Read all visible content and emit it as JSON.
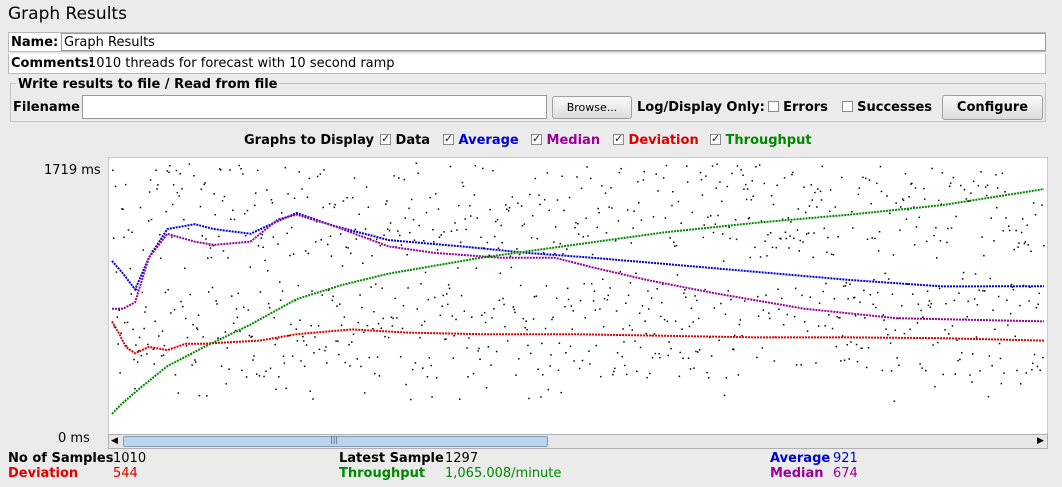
{
  "title": "Graph Results",
  "name": {
    "label": "Name:",
    "value": "Graph Results"
  },
  "comments": {
    "label": "Comments:",
    "value": "1010 threads for forecast with 10 second ramp"
  },
  "file_group": {
    "legend": "Write results to file / Read from file",
    "filename_label": "Filename",
    "filename_value": "",
    "browse_label": "Browse...",
    "log_label": "Log/Display Only:",
    "errors_label": "Errors",
    "errors_checked": false,
    "successes_label": "Successes",
    "successes_checked": false,
    "configure_label": "Configure"
  },
  "graphs": {
    "label": "Graphs to Display",
    "items": [
      {
        "label": "Data",
        "checked": true,
        "color": "#000000"
      },
      {
        "label": "Average",
        "checked": true,
        "color": "#0000cc"
      },
      {
        "label": "Median",
        "checked": true,
        "color": "#990099"
      },
      {
        "label": "Deviation",
        "checked": true,
        "color": "#dd0000"
      },
      {
        "label": "Throughput",
        "checked": true,
        "color": "#008800"
      }
    ]
  },
  "chart_data": {
    "type": "scatter",
    "ylim": [
      0,
      1719
    ],
    "y_tick_labels": [
      "1719 ms",
      "0 ms"
    ],
    "x_count": 1010,
    "series": [
      {
        "name": "Average",
        "color": "#0000cc",
        "x": [
          0,
          12,
          25,
          40,
          60,
          90,
          110,
          150,
          180,
          200,
          240,
          300,
          380,
          450,
          520,
          600,
          700,
          800,
          900,
          1010
        ],
        "values": [
          1080,
          1000,
          900,
          1100,
          1280,
          1310,
          1280,
          1250,
          1330,
          1380,
          1300,
          1210,
          1170,
          1130,
          1100,
          1060,
          1010,
          960,
          920,
          921
        ]
      },
      {
        "name": "Median",
        "color": "#990099",
        "x": [
          0,
          12,
          25,
          40,
          60,
          90,
          110,
          150,
          180,
          200,
          240,
          300,
          350,
          420,
          480,
          520,
          580,
          650,
          750,
          850,
          1010
        ],
        "values": [
          780,
          780,
          820,
          1100,
          1250,
          1200,
          1180,
          1200,
          1340,
          1370,
          1300,
          1170,
          1130,
          1100,
          1100,
          1040,
          960,
          880,
          780,
          720,
          700
        ]
      },
      {
        "name": "Deviation",
        "color": "#dd0000",
        "x": [
          0,
          8,
          15,
          25,
          40,
          60,
          80,
          100,
          130,
          160,
          200,
          260,
          320,
          400,
          500,
          600,
          700,
          800,
          900,
          1010
        ],
        "values": [
          700,
          620,
          540,
          500,
          540,
          520,
          560,
          560,
          570,
          580,
          620,
          650,
          630,
          620,
          620,
          610,
          600,
          600,
          595,
          580
        ]
      },
      {
        "name": "Throughput",
        "color": "#008800",
        "x": [
          0,
          10,
          30,
          60,
          100,
          150,
          200,
          250,
          300,
          400,
          500,
          600,
          700,
          800,
          900,
          1010
        ],
        "values": [
          120,
          180,
          280,
          420,
          540,
          680,
          840,
          930,
          1000,
          1100,
          1180,
          1260,
          1320,
          1370,
          1430,
          1530
        ]
      }
    ]
  },
  "stats": {
    "samples_label": "No of Samples",
    "samples_value": "1010",
    "deviation_label": "Deviation",
    "deviation_value": "544",
    "latest_label": "Latest Sample",
    "latest_value": "1297",
    "throughput_label": "Throughput",
    "throughput_value": "1,065.008/minute",
    "average_label": "Average",
    "average_value": "921",
    "median_label": "Median",
    "median_value": "674"
  },
  "colors": {
    "average": "#0000cc",
    "median": "#990099",
    "deviation": "#dd0000",
    "throughput": "#008800",
    "scroll_thumb": "#bcd3ee"
  }
}
